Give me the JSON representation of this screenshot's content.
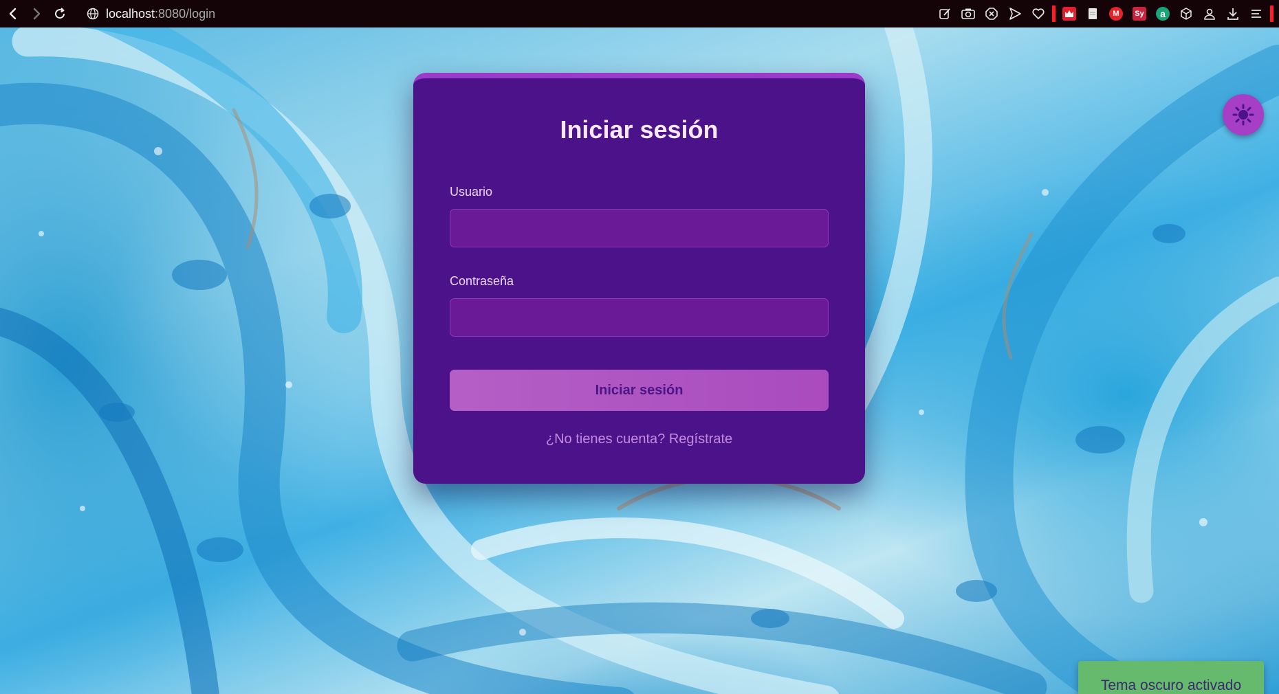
{
  "browser": {
    "url_host": "localhost",
    "url_port_path": ":8080/login",
    "extensions": {
      "badge_m": "M",
      "badge_sy": "Sy",
      "badge_a": "a"
    }
  },
  "login": {
    "title": "Iniciar sesión",
    "username_label": "Usuario",
    "username_value": "",
    "password_label": "Contraseña",
    "password_value": "",
    "submit_label": "Iniciar sesión",
    "register_link": "¿No tienes cuenta? Regístrate"
  },
  "toast": {
    "message": "Tema oscuro activado"
  },
  "colors": {
    "card_bg": "#4b1289",
    "input_bg": "#6a1a97",
    "button_bg": "#b55fc6",
    "toast_bg": "#66ba6d",
    "theme_toggle_bg": "#a63fc6"
  },
  "icons": {
    "back": "back-arrow-icon",
    "forward": "forward-arrow-icon",
    "reload": "reload-icon",
    "site": "globe-icon",
    "theme_toggle": "sun-icon"
  }
}
